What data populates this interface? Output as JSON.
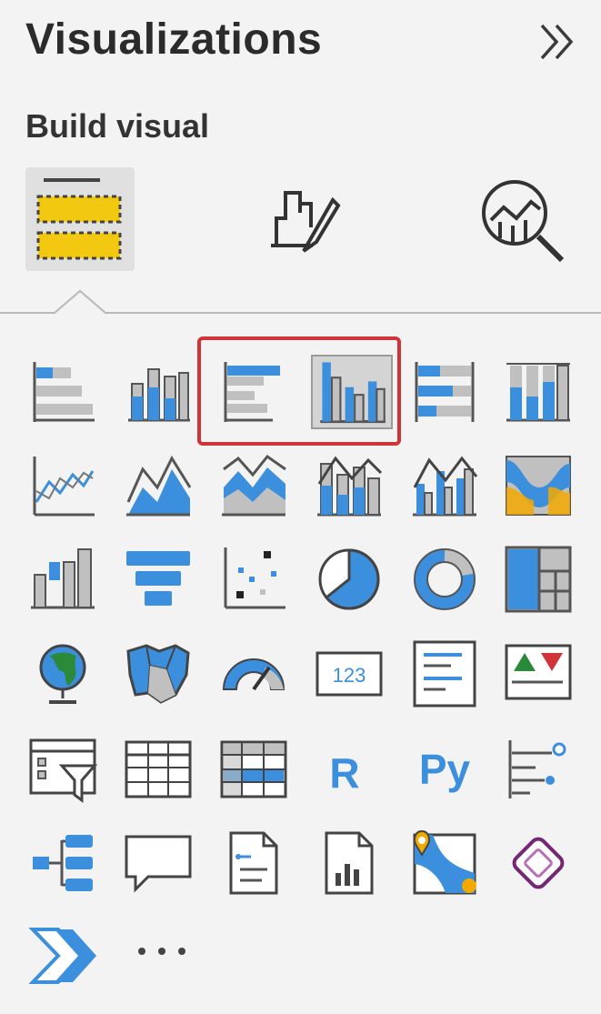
{
  "panel": {
    "title": "Visualizations",
    "subtitle": "Build visual",
    "expand_icon": "chevron-double-right-icon"
  },
  "modes": [
    {
      "name": "build-visual",
      "icon": "fields-well-icon",
      "selected": true
    },
    {
      "name": "format-visual",
      "icon": "paintbrush-chart-icon",
      "selected": false
    },
    {
      "name": "analytics",
      "icon": "magnifier-chart-icon",
      "selected": false
    }
  ],
  "colors": {
    "accent_blue": "#3b8fdd",
    "accent_yellow": "#f2c811",
    "icon_gray": "#505050",
    "highlight_red": "#d13438"
  },
  "icons": {
    "r_label": "R",
    "py_label": "Py",
    "card_label": "123",
    "more_label": "..."
  },
  "visuals": [
    "stacked-bar-chart",
    "stacked-column-chart",
    "clustered-bar-chart",
    "clustered-column-chart",
    "100-stacked-bar-chart",
    "100-stacked-column-chart",
    "line-chart",
    "area-chart",
    "stacked-area-chart",
    "line-and-stacked-column-chart",
    "line-and-clustered-column-chart",
    "ribbon-chart",
    "waterfall-chart",
    "funnel",
    "scatter-chart",
    "pie-chart",
    "donut-chart",
    "treemap",
    "map",
    "filled-map",
    "gauge",
    "card",
    "multi-row-card",
    "kpi",
    "slicer",
    "table",
    "matrix",
    "r-script-visual",
    "python-visual",
    "key-influencers",
    "decomposition-tree",
    "qa",
    "smart-narrative",
    "paginated-report",
    "azure-map",
    "power-apps",
    "power-automate",
    "more-visuals"
  ]
}
